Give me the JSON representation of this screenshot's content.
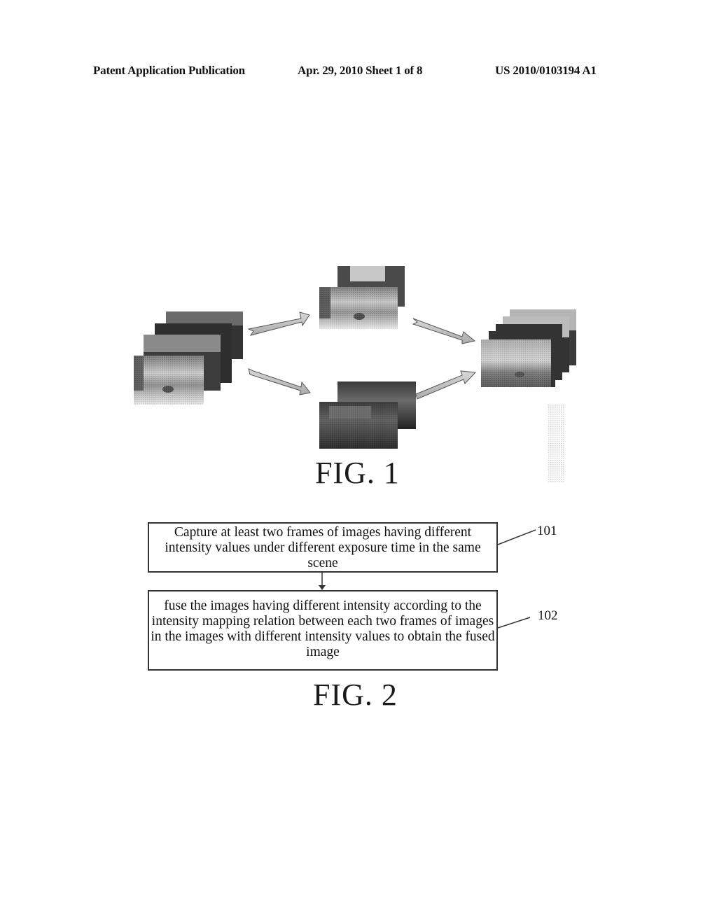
{
  "header": {
    "publication_type": "Patent Application Publication",
    "date_sheet": "Apr. 29, 2010  Sheet 1 of 8",
    "patent_number": "US 2010/0103194 A1"
  },
  "figure1": {
    "label": "FIG. 1",
    "panels": [
      {
        "name": "input-image-stack",
        "description": "stack of captured frames with different exposures"
      },
      {
        "name": "bright-image-pair",
        "description": "brighter intensity frames"
      },
      {
        "name": "dark-image-pair",
        "description": "darker intensity frames"
      },
      {
        "name": "fused-image-stack",
        "description": "fused output frames"
      }
    ]
  },
  "figure2": {
    "label": "FIG. 2",
    "steps": [
      {
        "ref": "101",
        "text": "Capture at least two frames of images having different intensity values under different exposure time in the same scene"
      },
      {
        "ref": "102",
        "text": "fuse the images having different intensity according to the intensity mapping relation between each two frames of images in the images with different intensity values to obtain the fused image"
      }
    ]
  }
}
